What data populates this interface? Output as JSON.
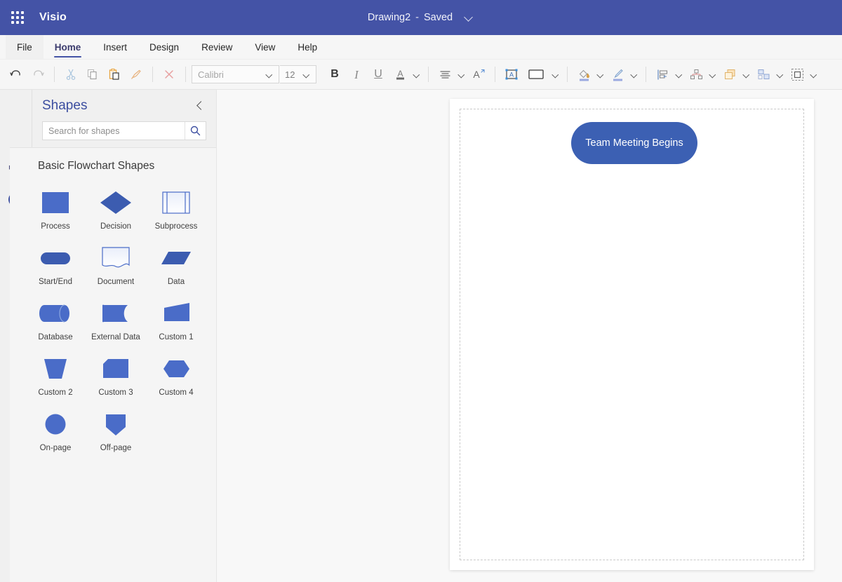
{
  "titlebar": {
    "app_launcher": "app-launcher-waffle",
    "app_name": "Visio",
    "document_name": "Drawing2",
    "separator": "-",
    "save_status": "Saved",
    "background_color": "#4453a6"
  },
  "ribbon": {
    "tabs": [
      {
        "label": "File",
        "active": false
      },
      {
        "label": "Home",
        "active": true
      },
      {
        "label": "Insert",
        "active": false
      },
      {
        "label": "Design",
        "active": false
      },
      {
        "label": "Review",
        "active": false
      },
      {
        "label": "View",
        "active": false
      },
      {
        "label": "Help",
        "active": false
      }
    ],
    "accent_color": "#4453a6",
    "tools": {
      "undo": "Undo",
      "redo": "Redo",
      "cut": "Cut",
      "copy": "Copy",
      "paste": "Paste",
      "format_painter": "Format Painter",
      "clear": "Clear",
      "font_name": "Calibri",
      "font_size": "12",
      "bold": "B",
      "italic": "I",
      "underline": "U",
      "font_color": "A",
      "paragraph_align": "Align",
      "text_direction": "A",
      "text_box": "Text Box",
      "shape_gallery": "Shape Styles",
      "fill": "Fill",
      "line": "Line",
      "align": "Align",
      "position": "Position",
      "bring_forward": "Bring Forward",
      "group": "Group",
      "select": "Select"
    }
  },
  "sidebar": {
    "title": "Shapes",
    "collapse": "Collapse pane",
    "search": {
      "placeholder": "Search for shapes",
      "value": ""
    },
    "rail": {
      "stencil_icon": "flowchart-stencil-icon",
      "add_label": "+"
    },
    "stencil": {
      "name": "Basic Flowchart Shapes",
      "shapes": [
        {
          "label": "Process",
          "art": "rect"
        },
        {
          "label": "Decision",
          "art": "diamond"
        },
        {
          "label": "Subprocess",
          "art": "subprocess"
        },
        {
          "label": "Start/End",
          "art": "pill"
        },
        {
          "label": "Document",
          "art": "document"
        },
        {
          "label": "Data",
          "art": "parallelogram"
        },
        {
          "label": "Database",
          "art": "cylinder"
        },
        {
          "label": "External Data",
          "art": "externaldata"
        },
        {
          "label": "Custom 1",
          "art": "custom1"
        },
        {
          "label": "Custom 2",
          "art": "trapezoid"
        },
        {
          "label": "Custom 3",
          "art": "custom3"
        },
        {
          "label": "Custom 4",
          "art": "hexagon"
        },
        {
          "label": "On-page",
          "art": "circle"
        },
        {
          "label": "Off-page",
          "art": "offpage"
        }
      ],
      "shape_color": "#4a6cc8"
    }
  },
  "canvas": {
    "page_background": "#ffffff",
    "workspace_background": "#f8f8f8",
    "shapes": [
      {
        "text": "Team Meeting Begins",
        "type": "start-end",
        "fill": "#3c60b3",
        "text_color": "#ffffff"
      }
    ]
  }
}
